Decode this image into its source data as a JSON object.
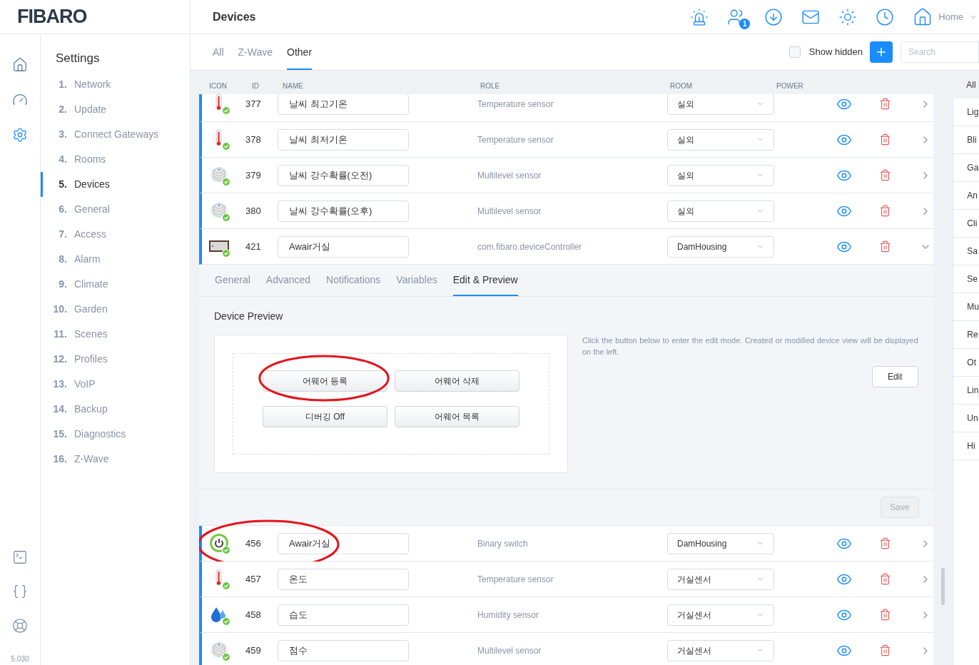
{
  "logo": "FIBARO",
  "page_title": "Devices",
  "header": {
    "icons": [
      {
        "kind": "alarm"
      },
      {
        "kind": "users",
        "badge": "1"
      },
      {
        "kind": "download"
      },
      {
        "kind": "mail"
      },
      {
        "kind": "sun"
      },
      {
        "kind": "clock"
      }
    ],
    "location": "Home"
  },
  "rail": {
    "items": [
      {
        "kind": "home",
        "selected": false
      },
      {
        "kind": "gauge",
        "selected": false
      },
      {
        "kind": "settings",
        "selected": true
      }
    ],
    "tools": [
      {
        "kind": "terminal"
      },
      {
        "kind": "braces"
      },
      {
        "kind": "lifebuoy"
      }
    ],
    "version": "5.030"
  },
  "settings": {
    "title": "Settings",
    "items": [
      {
        "number": "1.",
        "label": "Network",
        "selected": false
      },
      {
        "number": "2.",
        "label": "Update",
        "selected": false
      },
      {
        "number": "3.",
        "label": "Connect Gateways",
        "selected": false
      },
      {
        "number": "4.",
        "label": "Rooms",
        "selected": false
      },
      {
        "number": "5.",
        "label": "Devices",
        "selected": true
      },
      {
        "number": "6.",
        "label": "General",
        "selected": false
      },
      {
        "number": "7.",
        "label": "Access",
        "selected": false
      },
      {
        "number": "8.",
        "label": "Alarm",
        "selected": false
      },
      {
        "number": "9.",
        "label": "Climate",
        "selected": false
      },
      {
        "number": "10.",
        "label": "Garden",
        "selected": false
      },
      {
        "number": "11.",
        "label": "Scenes",
        "selected": false
      },
      {
        "number": "12.",
        "label": "Profiles",
        "selected": false
      },
      {
        "number": "13.",
        "label": "VoIP",
        "selected": false
      },
      {
        "number": "14.",
        "label": "Backup",
        "selected": false
      },
      {
        "number": "15.",
        "label": "Diagnostics",
        "selected": false
      },
      {
        "number": "16.",
        "label": "Z-Wave",
        "selected": false
      }
    ]
  },
  "filter_tabs": [
    {
      "label": "All",
      "selected": false
    },
    {
      "label": "Z-Wave",
      "selected": false
    },
    {
      "label": "Other",
      "selected": true
    }
  ],
  "show_hidden": {
    "label": "Show hidden",
    "checked": false
  },
  "search": {
    "placeholder": "Search"
  },
  "columns": [
    "ICON",
    "ID",
    "NAME",
    "ROLE",
    "ROOM",
    "POWER"
  ],
  "devices": [
    {
      "kind": "thermometer",
      "id": "377",
      "name": "날씨 최고기온",
      "role": "Temperature sensor",
      "room": "실외",
      "expanded": false,
      "circled": false
    },
    {
      "kind": "thermometer",
      "id": "378",
      "name": "날씨 최저기온",
      "role": "Temperature sensor",
      "room": "실외",
      "expanded": false,
      "circled": false
    },
    {
      "kind": "multilevel",
      "id": "379",
      "name": "날씨 강수확률(오전)",
      "role": "Multilevel sensor",
      "room": "실외",
      "expanded": false,
      "circled": false
    },
    {
      "kind": "multilevel",
      "id": "380",
      "name": "날씨 강수확률(오후)",
      "role": "Multilevel sensor",
      "room": "실외",
      "expanded": false,
      "circled": false
    },
    {
      "kind": "controller",
      "id": "421",
      "name": "Awair거실",
      "role": "com.fibaro.deviceController",
      "room": "DamHousing",
      "expanded": true,
      "circled": false
    },
    {
      "kind": "switch",
      "id": "456",
      "name": "Awair거실",
      "role": "Binary switch",
      "room": "DamHousing",
      "expanded": false,
      "circled": true
    },
    {
      "kind": "thermometer",
      "id": "457",
      "name": "온도",
      "role": "Temperature sensor",
      "room": "거실센서",
      "expanded": false,
      "circled": false
    },
    {
      "kind": "humidity",
      "id": "458",
      "name": "습도",
      "role": "Humidity sensor",
      "room": "거실센서",
      "expanded": false,
      "circled": false
    },
    {
      "kind": "multilevel",
      "id": "459",
      "name": "점수",
      "role": "Multilevel sensor",
      "room": "거실센서",
      "expanded": false,
      "circled": false
    }
  ],
  "panel": {
    "tabs": [
      {
        "label": "General",
        "selected": false
      },
      {
        "label": "Advanced",
        "selected": false
      },
      {
        "label": "Notifications",
        "selected": false
      },
      {
        "label": "Variables",
        "selected": false
      },
      {
        "label": "Edit & Preview",
        "selected": true
      }
    ],
    "heading": "Device Preview",
    "preview_buttons": [
      {
        "label": "어웨어 등록",
        "circled": true
      },
      {
        "label": "어웨어 삭제",
        "circled": false
      },
      {
        "label": "디버깅 Off",
        "circled": false
      },
      {
        "label": "어웨어 목록",
        "circled": false
      }
    ],
    "hint": "Click the button below to enter the edit mode. Created or modified device view will be displayed on the left.",
    "edit_button": "Edit",
    "save_button": {
      "label": "Save",
      "disabled": true
    }
  },
  "categories": [
    {
      "label": "All",
      "kind": "header"
    },
    {
      "label": "Lig",
      "kind": "item"
    },
    {
      "label": "Bli",
      "kind": "item"
    },
    {
      "label": "Ga",
      "kind": "item"
    },
    {
      "label": "An",
      "kind": "item"
    },
    {
      "label": "Cli",
      "kind": "item"
    },
    {
      "label": "Sa",
      "kind": "item"
    },
    {
      "label": "Se",
      "kind": "item"
    },
    {
      "label": "Mu",
      "kind": "item"
    },
    {
      "label": "Re",
      "kind": "item"
    },
    {
      "label": "Ot",
      "kind": "item"
    },
    {
      "label": "Lin",
      "kind": "item"
    },
    {
      "label": "Un",
      "kind": "item"
    },
    {
      "label": "Hi",
      "kind": "item"
    }
  ]
}
